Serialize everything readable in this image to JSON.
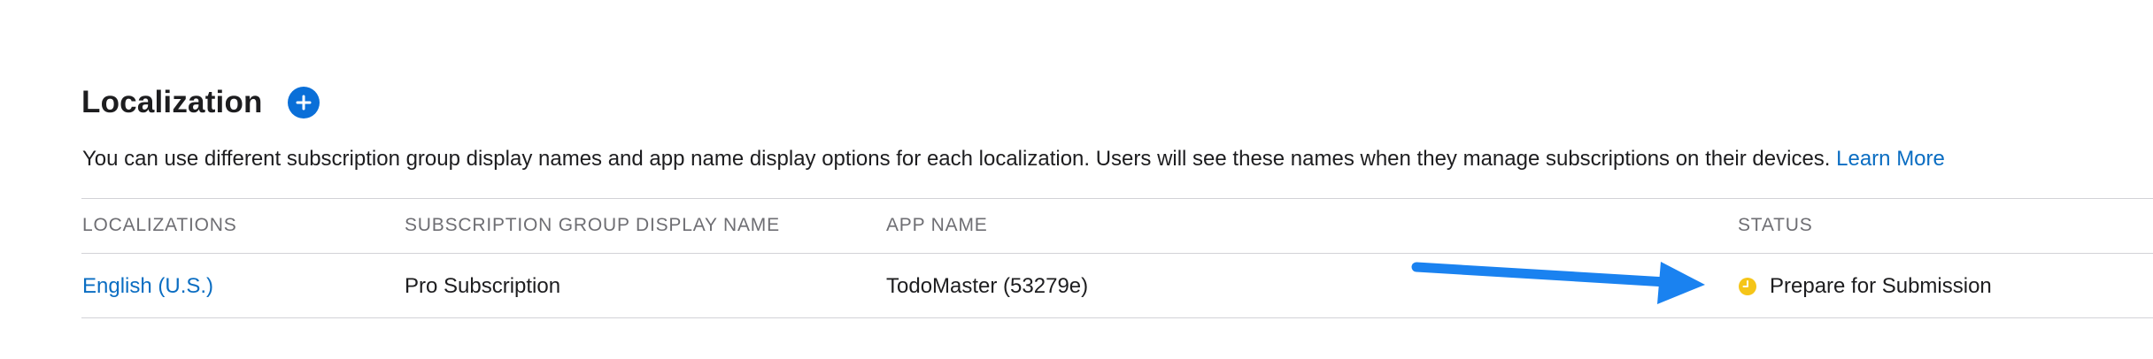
{
  "section": {
    "title": "Localization",
    "add_icon": "plus-circle-icon",
    "description": "You can use different subscription group display names and app name display options for each localization. Users will see these names when they manage subscriptions on their devices.",
    "learn_more": "Learn More"
  },
  "table": {
    "columns": [
      "LOCALIZATIONS",
      "SUBSCRIPTION GROUP DISPLAY NAME",
      "APP NAME",
      "STATUS"
    ],
    "rows": [
      {
        "localization": "English (U.S.)",
        "display_name": "Pro Subscription",
        "app_name": "TodoMaster (53279e)",
        "status": "Prepare for Submission",
        "status_icon": "clock-status-icon"
      }
    ]
  },
  "colors": {
    "accent": "#0a6dc2",
    "status_dot": "#f5c518",
    "annotation_arrow": "#1a82f0"
  }
}
